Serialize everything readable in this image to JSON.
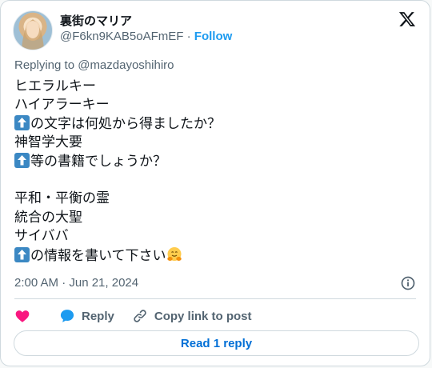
{
  "author": {
    "name": "裏街のマリア",
    "handle": "@F6kn9KAB5oAFmEF",
    "separator": " · ",
    "follow_label": "Follow"
  },
  "replying_to": "Replying to @mazdayoshihiro",
  "tweet_lines": [
    {
      "emoji": "",
      "text": "ヒエラルキー"
    },
    {
      "emoji": "",
      "text": "ハイアラーキー"
    },
    {
      "emoji": "up-arrow-emoji",
      "text": "の文字は何処から得ましたか？"
    },
    {
      "emoji": "",
      "text": "神智学大要"
    },
    {
      "emoji": "up-arrow-emoji",
      "text": "等の書籍でしょうか？"
    },
    {
      "emoji": "",
      "text": ""
    },
    {
      "emoji": "",
      "text": "平和・平衡の霊"
    },
    {
      "emoji": "",
      "text": "統合の大聖"
    },
    {
      "emoji": "",
      "text": "サイババ"
    },
    {
      "emoji": "up-arrow-emoji",
      "text": "の情報を書いて下さい"
    }
  ],
  "timestamp": "2:00 AM · Jun 21, 2024",
  "actions": {
    "reply_label": "Reply",
    "copy_label": "Copy link to post"
  },
  "read_reply_label": "Read 1 reply",
  "colors": {
    "accent": "#1d9bf0",
    "like": "#f91880",
    "emoji_blue": "#3b88c3"
  }
}
